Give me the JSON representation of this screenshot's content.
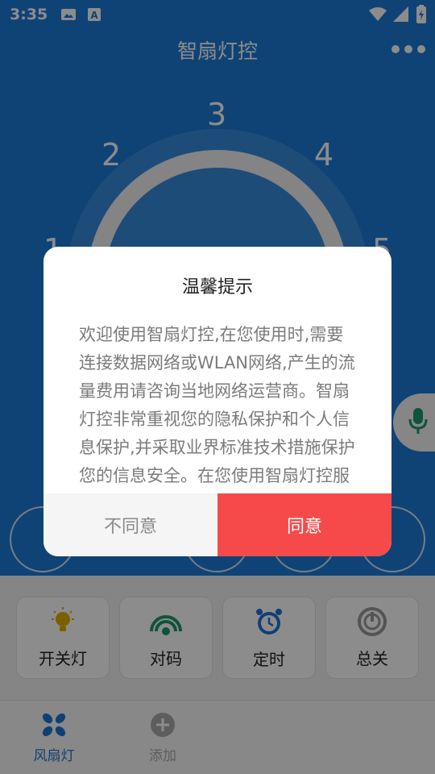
{
  "status_bar": {
    "time": "3:35",
    "icons": [
      "image-icon",
      "text-icon",
      "wifi-icon",
      "signal-icon",
      "battery-charging-icon"
    ]
  },
  "header": {
    "title": "智扇灯控",
    "more_icon": "more-dots-icon"
  },
  "dial": {
    "numbers": [
      "1",
      "2",
      "3",
      "4",
      "5"
    ]
  },
  "action_cards": [
    {
      "label": "开关灯",
      "icon": "lightbulb-icon",
      "color": "#d9a400"
    },
    {
      "label": "对码",
      "icon": "signal-arc-icon",
      "color": "#1a9a6b"
    },
    {
      "label": "定时",
      "icon": "alarm-clock-icon",
      "color": "#1f73d6"
    },
    {
      "label": "总关",
      "icon": "power-icon",
      "color": "#9a9a9a"
    }
  ],
  "tab_bar": {
    "tabs": [
      {
        "label": "风扇灯",
        "icon": "fan-icon",
        "active": true,
        "color": "#1f73d6"
      },
      {
        "label": "添加",
        "icon": "plus-circle-icon",
        "active": false,
        "color": "#aaaaaa"
      }
    ]
  },
  "dialog": {
    "title": "温馨提示",
    "body": "欢迎使用智扇灯控,在您使用时,需要连接数据网络或WLAN网络,产生的流量费用请咨询当地网络运营商。智扇灯控非常重视您的隐私保护和个人信息保护,并采取业界标准技术措施保护您的信息安全。在您使用智扇灯控服务前,请您务必仔细阅读",
    "disagree_label": "不同意",
    "agree_label": "同意",
    "agree_color": "#f64a4a"
  }
}
